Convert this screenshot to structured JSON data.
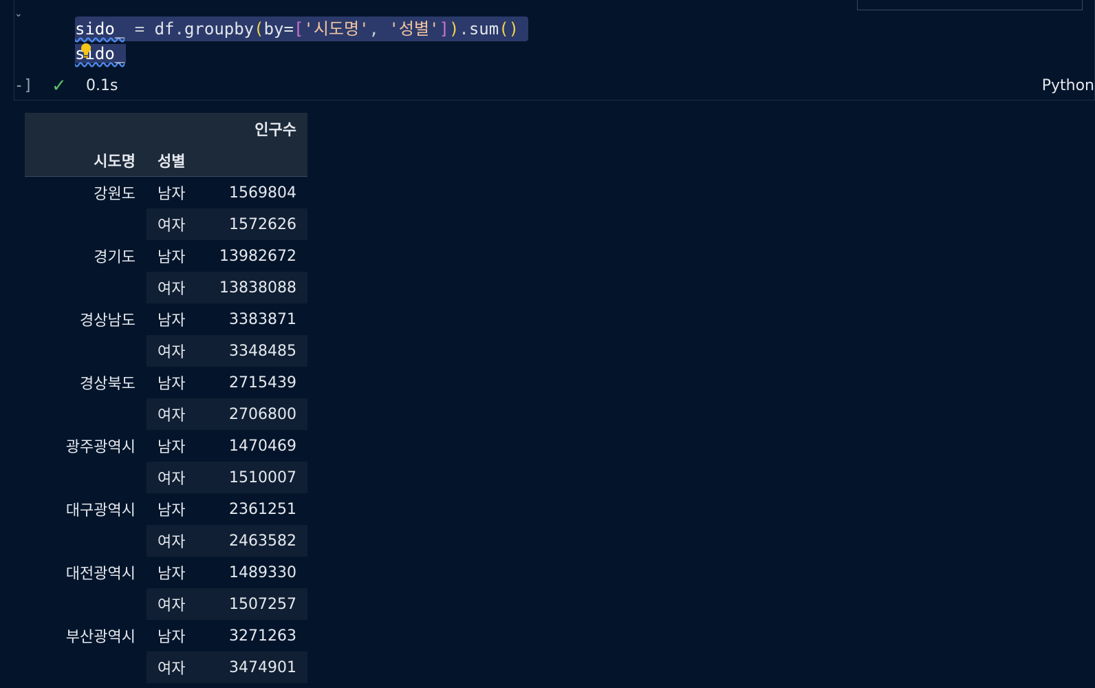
{
  "code": {
    "line1": {
      "var": "sido_",
      "eq": " = ",
      "obj": "df",
      "dot1": ".",
      "fn1": "groupby",
      "open_paren": "(",
      "kw": "by=",
      "open_brack": "[",
      "str1": "'시도명'",
      "comma": ", ",
      "str2": "'성별'",
      "close_brack": "]",
      "close_paren": ")",
      "dot2": ".",
      "fn2": "sum",
      "call": "()"
    },
    "line2": "sido_"
  },
  "status": {
    "time": "0.1s",
    "language": "Python"
  },
  "table": {
    "value_column": "인구수",
    "index_names": [
      "시도명",
      "성별"
    ],
    "rows": [
      {
        "region": "강원도",
        "sex": "남자",
        "value": "1569804"
      },
      {
        "region": "",
        "sex": "여자",
        "value": "1572626"
      },
      {
        "region": "경기도",
        "sex": "남자",
        "value": "13982672"
      },
      {
        "region": "",
        "sex": "여자",
        "value": "13838088"
      },
      {
        "region": "경상남도",
        "sex": "남자",
        "value": "3383871"
      },
      {
        "region": "",
        "sex": "여자",
        "value": "3348485"
      },
      {
        "region": "경상북도",
        "sex": "남자",
        "value": "2715439"
      },
      {
        "region": "",
        "sex": "여자",
        "value": "2706800"
      },
      {
        "region": "광주광역시",
        "sex": "남자",
        "value": "1470469"
      },
      {
        "region": "",
        "sex": "여자",
        "value": "1510007"
      },
      {
        "region": "대구광역시",
        "sex": "남자",
        "value": "2361251"
      },
      {
        "region": "",
        "sex": "여자",
        "value": "2463582"
      },
      {
        "region": "대전광역시",
        "sex": "남자",
        "value": "1489330"
      },
      {
        "region": "",
        "sex": "여자",
        "value": "1507257"
      },
      {
        "region": "부산광역시",
        "sex": "남자",
        "value": "3271263"
      },
      {
        "region": "",
        "sex": "여자",
        "value": "3474901"
      }
    ]
  },
  "icons": {
    "collapse": "chevron-down-icon",
    "status": "check-icon",
    "hint": "lightbulb-icon"
  },
  "colors": {
    "background": "#04152b",
    "selection": "#2b3a6b",
    "check": "#5fbf6a",
    "bulb": "#f5c518"
  }
}
